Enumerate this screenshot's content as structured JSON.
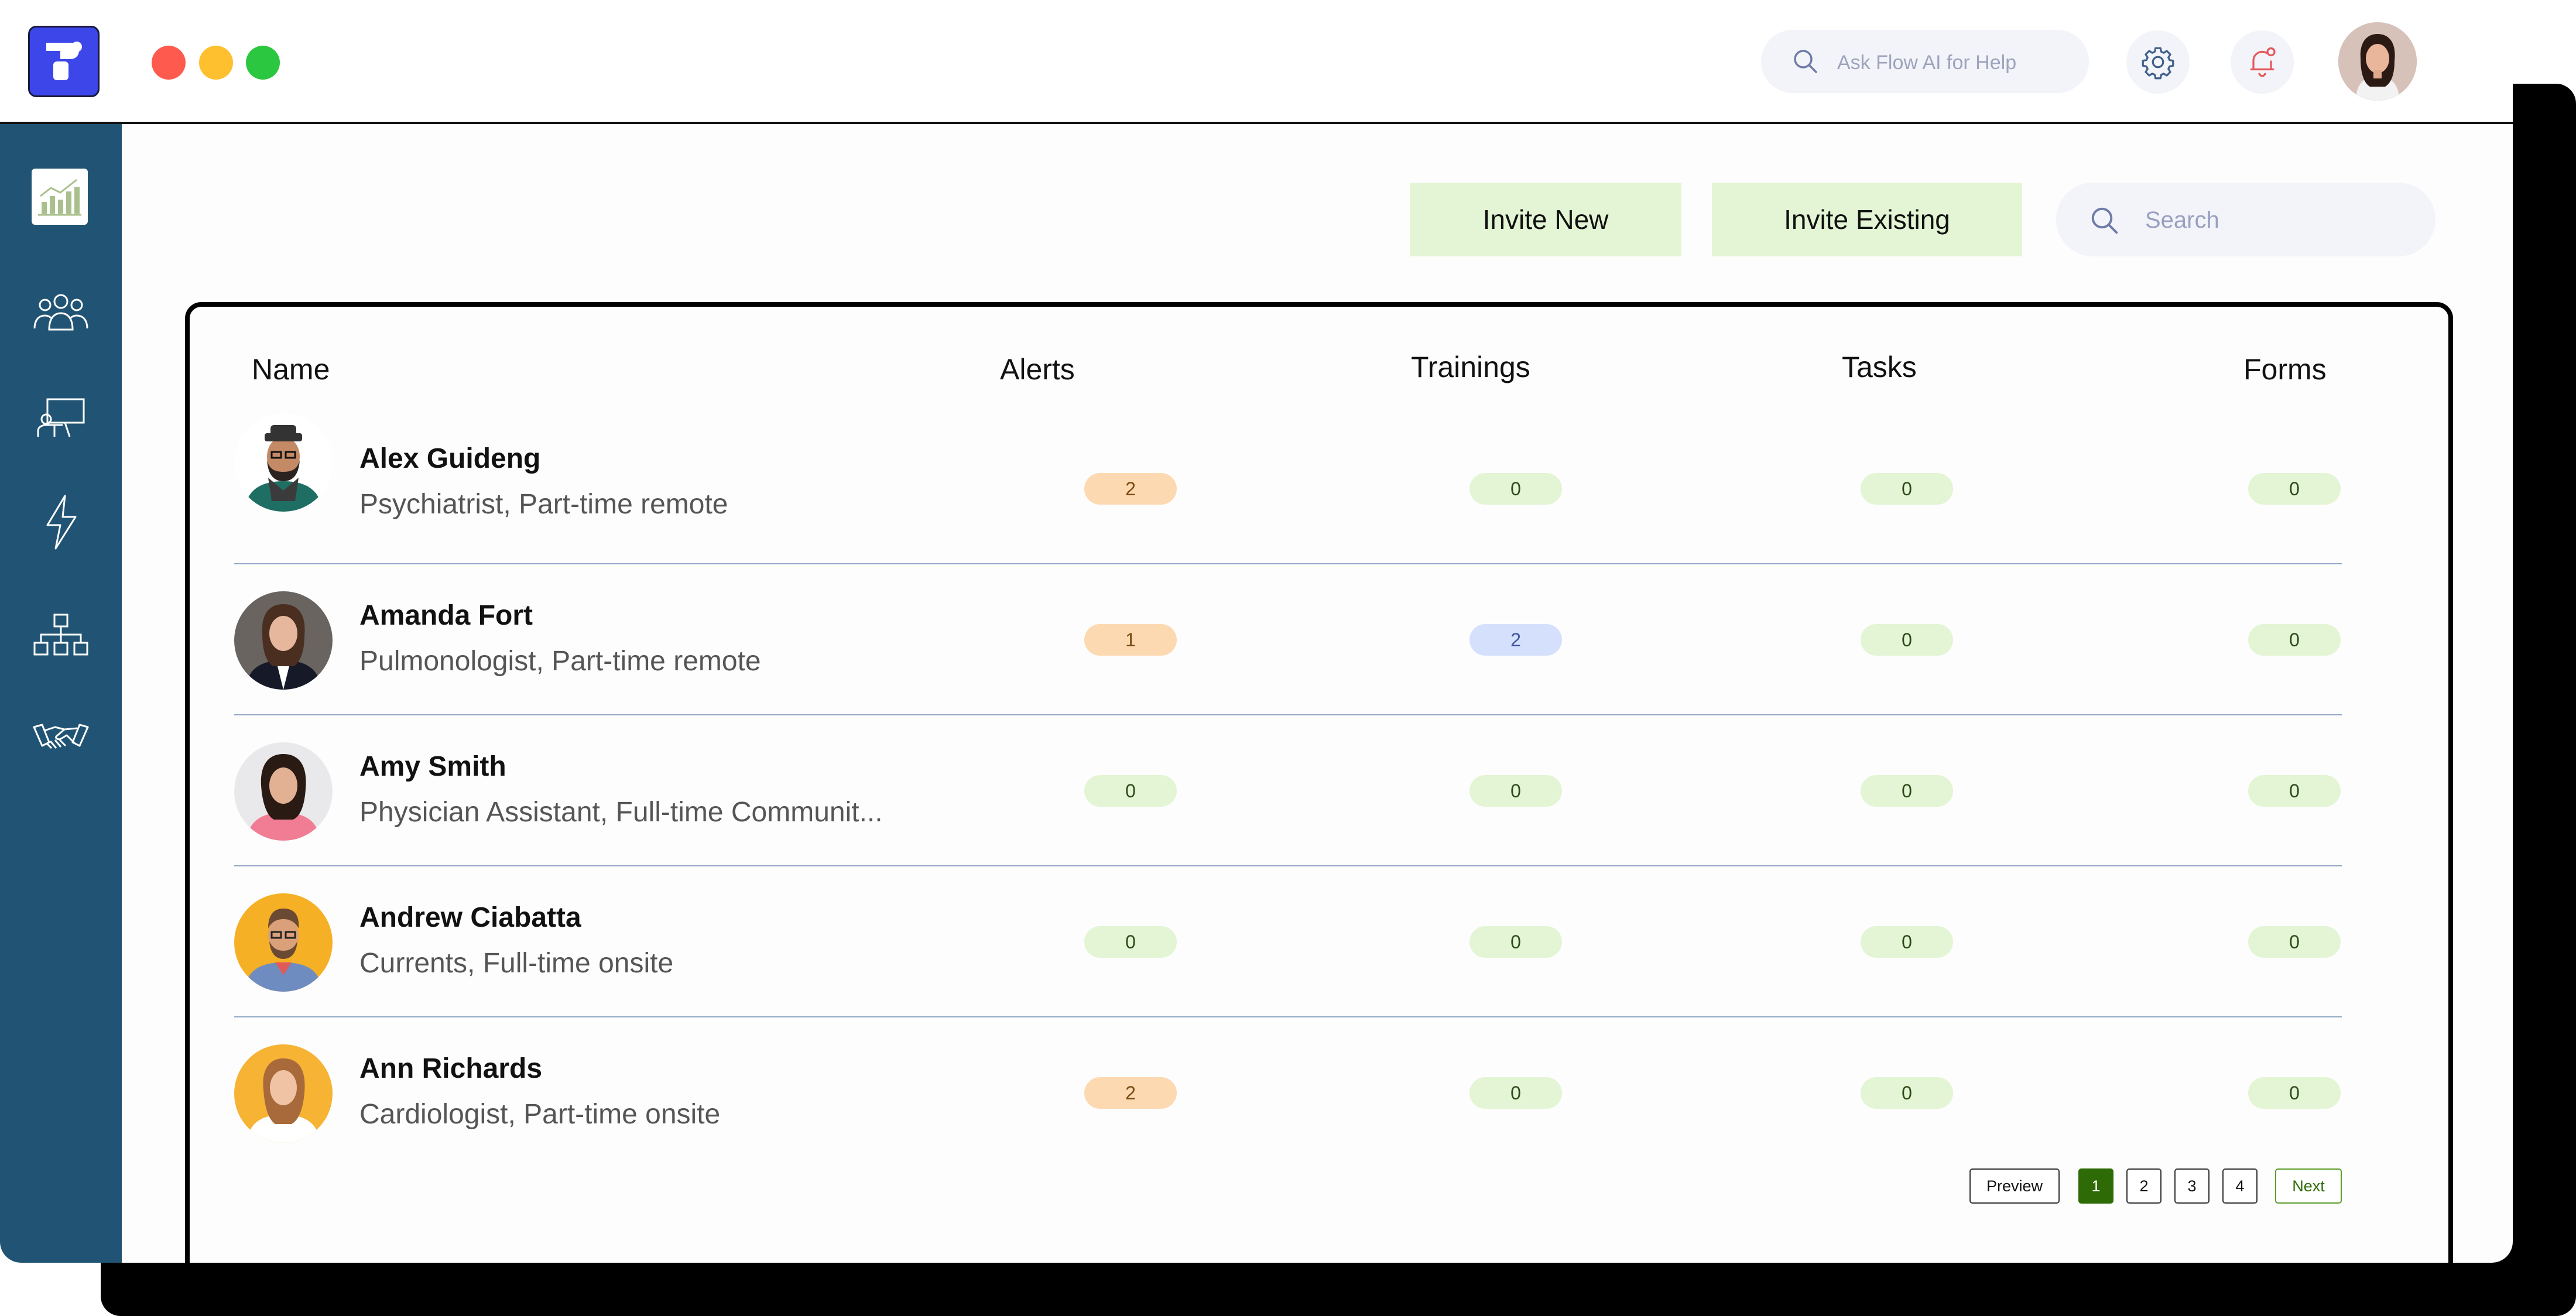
{
  "header": {
    "ai_search_placeholder": "Ask Flow AI for Help"
  },
  "sidebar": {
    "items": [
      {
        "icon": "analytics-chart-icon",
        "active": true
      },
      {
        "icon": "team-icon",
        "active": false
      },
      {
        "icon": "presentation-icon",
        "active": false
      },
      {
        "icon": "lightning-icon",
        "active": false
      },
      {
        "icon": "org-chart-icon",
        "active": false
      },
      {
        "icon": "handshake-icon",
        "active": false
      }
    ]
  },
  "toolbar": {
    "invite_new_label": "Invite New",
    "invite_existing_label": "Invite Existing",
    "search_placeholder": "Search"
  },
  "table": {
    "columns": {
      "name": "Name",
      "alerts": "Alerts",
      "trainings": "Trainings",
      "tasks": "Tasks",
      "forms": "Forms"
    },
    "rows": [
      {
        "name": "Alex Guideng",
        "role": "Psychiatrist, Part-time remote",
        "alerts": "2",
        "trainings": "0",
        "tasks": "0",
        "forms": "0"
      },
      {
        "name": "Amanda Fort",
        "role": "Pulmonologist, Part-time remote",
        "alerts": "1",
        "trainings": "2",
        "tasks": "0",
        "forms": "0"
      },
      {
        "name": "Amy Smith",
        "role": "Physician Assistant, Full-time Communit...",
        "alerts": "0",
        "trainings": "0",
        "tasks": "0",
        "forms": "0"
      },
      {
        "name": "Andrew Ciabatta",
        "role": "Currents, Full-time onsite",
        "alerts": "0",
        "trainings": "0",
        "tasks": "0",
        "forms": "0"
      },
      {
        "name": "Ann Richards",
        "role": "Cardiologist, Part-time onsite",
        "alerts": "2",
        "trainings": "0",
        "tasks": "0",
        "forms": "0"
      }
    ]
  },
  "pagination": {
    "prev_label": "Preview",
    "pages": [
      "1",
      "2",
      "3",
      "4"
    ],
    "current_page": "1",
    "next_label": "Next"
  },
  "colors": {
    "sidebar": "#215474",
    "logo": "#3d46e8",
    "button_green": "#e3f5d4",
    "pill_orange": "#fdd9b1",
    "pill_green": "#e3f5d4",
    "pill_blue": "#d5e0fc",
    "page_active": "#2e6b07"
  }
}
